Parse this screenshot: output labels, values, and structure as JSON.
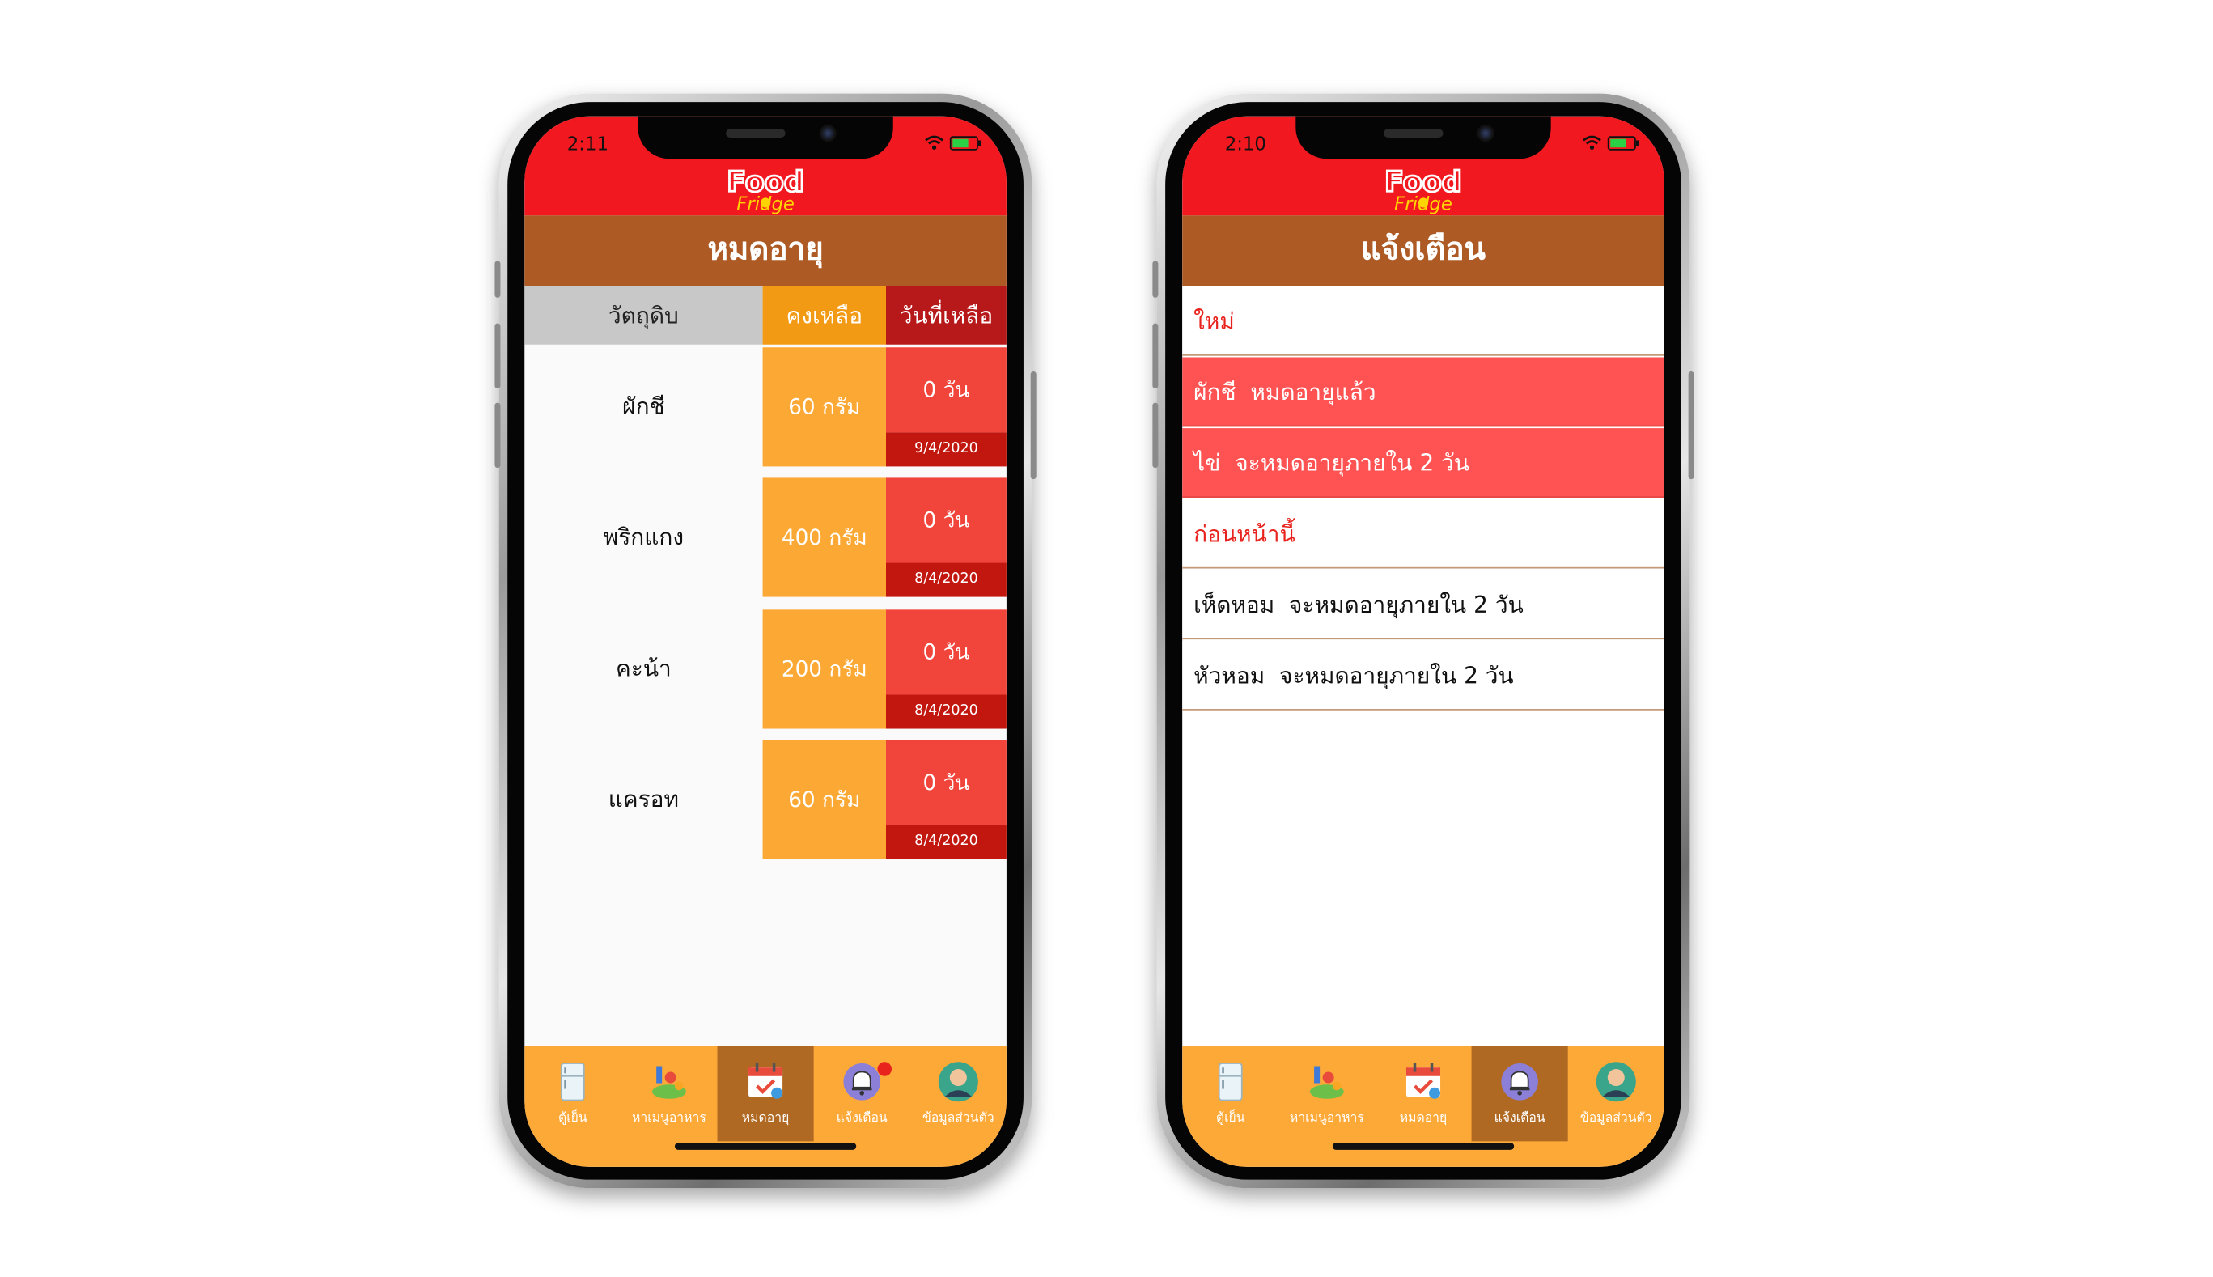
{
  "colors": {
    "topbar_red": "#f2181f",
    "header_brown": "#ad5a24",
    "tabbar_orange": "#fda938",
    "tab_active": "#b06922",
    "qty_orange": "#fba834",
    "days_red": "#f1443a",
    "date_darkred": "#c2170f",
    "alert_red": "#ff5252",
    "section_red": "#e8231e"
  },
  "logo_icon": "food-fridge-logo-icon",
  "tabs": [
    {
      "label": "ตู้เย็น",
      "icon": "fridge-icon"
    },
    {
      "label": "หาเมนูอาหาร",
      "icon": "groceries-icon"
    },
    {
      "label": "หมดอายุ",
      "icon": "calendar-icon"
    },
    {
      "label": "แจ้งเตือน",
      "icon": "bell-icon"
    },
    {
      "label": "ข้อมูลส่วนตัว",
      "icon": "profile-avatar-icon"
    }
  ],
  "left_phone": {
    "status_time": "2:11",
    "header_title": "หมดอายุ",
    "active_tab": 2,
    "notification_badge_on_tab": 3,
    "table_headers": {
      "item": "วัตถุดิบ",
      "remaining": "คงเหลือ",
      "days_left": "วันที่เหลือ"
    },
    "rows": [
      {
        "name": "ผักชี",
        "qty": "60 กรัม",
        "days": "0 วัน",
        "date": "9/4/2020"
      },
      {
        "name": "พริกแกง",
        "qty": "400 กรัม",
        "days": "0 วัน",
        "date": "8/4/2020"
      },
      {
        "name": "คะน้า",
        "qty": "200 กรัม",
        "days": "0 วัน",
        "date": "8/4/2020"
      },
      {
        "name": "แครอท",
        "qty": "60 กรัม",
        "days": "0 วัน",
        "date": "8/4/2020"
      }
    ]
  },
  "right_phone": {
    "status_time": "2:10",
    "header_title": "แจ้งเตือน",
    "active_tab": 3,
    "section_new": "ใหม่",
    "new_items": [
      {
        "text": "ผักชี  หมดอายุแล้ว"
      },
      {
        "text": "ไข่  จะหมดอายุภายใน 2 วัน"
      }
    ],
    "section_earlier": "ก่อนหน้านี้",
    "earlier_items": [
      {
        "text": "เห็ดหอม  จะหมดอายุภายใน 2 วัน"
      },
      {
        "text": "หัวหอม  จะหมดอายุภายใน 2 วัน"
      }
    ]
  }
}
